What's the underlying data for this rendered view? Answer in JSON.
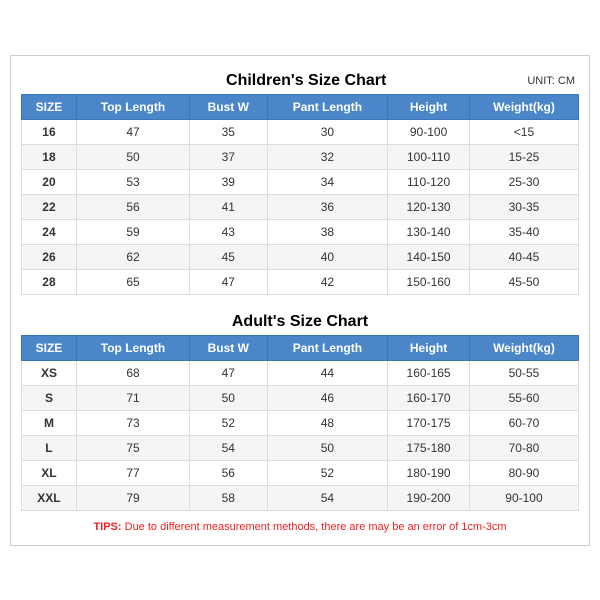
{
  "children_chart": {
    "title": "Children's Size Chart",
    "unit": "UNIT: CM",
    "headers": [
      "SIZE",
      "Top Length",
      "Bust W",
      "Pant Length",
      "Height",
      "Weight(kg)"
    ],
    "rows": [
      [
        "16",
        "47",
        "35",
        "30",
        "90-100",
        "<15"
      ],
      [
        "18",
        "50",
        "37",
        "32",
        "100-110",
        "15-25"
      ],
      [
        "20",
        "53",
        "39",
        "34",
        "110-120",
        "25-30"
      ],
      [
        "22",
        "56",
        "41",
        "36",
        "120-130",
        "30-35"
      ],
      [
        "24",
        "59",
        "43",
        "38",
        "130-140",
        "35-40"
      ],
      [
        "26",
        "62",
        "45",
        "40",
        "140-150",
        "40-45"
      ],
      [
        "28",
        "65",
        "47",
        "42",
        "150-160",
        "45-50"
      ]
    ]
  },
  "adult_chart": {
    "title": "Adult's Size Chart",
    "headers": [
      "SIZE",
      "Top Length",
      "Bust W",
      "Pant Length",
      "Height",
      "Weight(kg)"
    ],
    "rows": [
      [
        "XS",
        "68",
        "47",
        "44",
        "160-165",
        "50-55"
      ],
      [
        "S",
        "71",
        "50",
        "46",
        "160-170",
        "55-60"
      ],
      [
        "M",
        "73",
        "52",
        "48",
        "170-175",
        "60-70"
      ],
      [
        "L",
        "75",
        "54",
        "50",
        "175-180",
        "70-80"
      ],
      [
        "XL",
        "77",
        "56",
        "52",
        "180-190",
        "80-90"
      ],
      [
        "XXL",
        "79",
        "58",
        "54",
        "190-200",
        "90-100"
      ]
    ]
  },
  "tips": {
    "label": "TIPS:",
    "text": " Due to different measurement methods, there are may be an error of 1cm-3cm"
  }
}
